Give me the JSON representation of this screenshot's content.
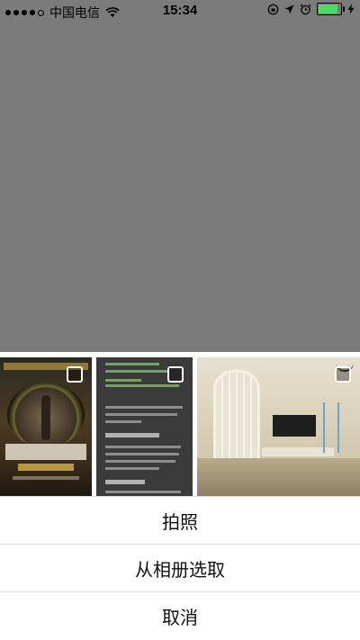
{
  "status_bar": {
    "carrier": "中国电信",
    "time": "15:34",
    "battery_percent": 90,
    "icons": [
      "signal-dots-icon",
      "wifi-icon",
      "orientation-lock-icon",
      "location-arrow-icon",
      "alarm-icon",
      "battery-icon",
      "charging-bolt-icon"
    ]
  },
  "photo_strip": {
    "photos": [
      {
        "name": "movie-poster"
      },
      {
        "name": "article-screenshot"
      },
      {
        "name": "living-room"
      }
    ]
  },
  "action_sheet": {
    "take_photo_label": "拍照",
    "choose_from_album_label": "从相册选取",
    "cancel_label": "取消"
  },
  "colors": {
    "dim_overlay": "#7b7b7b",
    "sheet_bg": "#ffffff",
    "separator": "#dcdcdc",
    "battery": "#4cd964"
  }
}
